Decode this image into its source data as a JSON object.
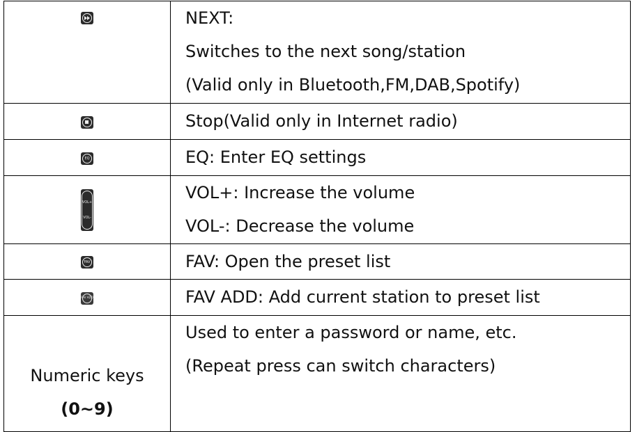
{
  "rows": [
    {
      "icon": "fast-forward-icon",
      "lines": [
        "NEXT:",
        "Switches to the next song/station",
        "(Valid only in Bluetooth,FM,DAB,Spotify)"
      ]
    },
    {
      "icon": "stop-icon",
      "lines": [
        "Stop(Valid only in Internet radio)"
      ]
    },
    {
      "icon": "eq-icon",
      "icon_text": "EQ",
      "lines": [
        "EQ: Enter EQ settings"
      ]
    },
    {
      "icon": "volume-rocker-icon",
      "icon_text_top": "VOL+",
      "icon_text_bottom": "VOL-",
      "lines": [
        "VOL+: Increase the volume",
        "VOL-: Decrease the volume"
      ]
    },
    {
      "icon": "fav-icon",
      "icon_text": "FAV",
      "lines": [
        "FAV: Open the preset list"
      ]
    },
    {
      "icon": "fav-add-icon",
      "icon_text": "FAV ADD",
      "lines": [
        "FAV ADD: Add current station to preset list"
      ]
    },
    {
      "key_label": "Numeric keys",
      "key_range": "(0~9)",
      "lines": [
        "Used to enter a password or name, etc.",
        "(Repeat press can switch characters)"
      ]
    }
  ]
}
